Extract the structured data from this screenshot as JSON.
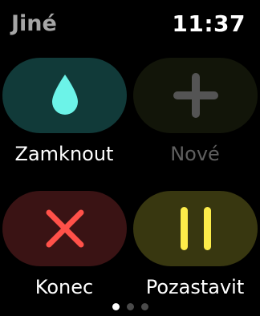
{
  "header": {
    "title": "Jiné",
    "time": "11:37"
  },
  "tiles": [
    {
      "label": "Zamknout",
      "icon": "water-drop-icon",
      "background": "#113a39",
      "icon_color": "#6cf3e8",
      "enabled": true
    },
    {
      "label": "Nové",
      "icon": "plus-icon",
      "background": "#121509",
      "icon_color": "#545454",
      "enabled": false
    },
    {
      "label": "Konec",
      "icon": "close-x-icon",
      "background": "#3a1314",
      "icon_color": "#ff5149",
      "enabled": true
    },
    {
      "label": "Pozastavit",
      "icon": "pause-icon",
      "background": "#383710",
      "icon_color": "#fcec4a",
      "enabled": true
    }
  ],
  "pagination": {
    "pages": 3,
    "current": 1
  }
}
